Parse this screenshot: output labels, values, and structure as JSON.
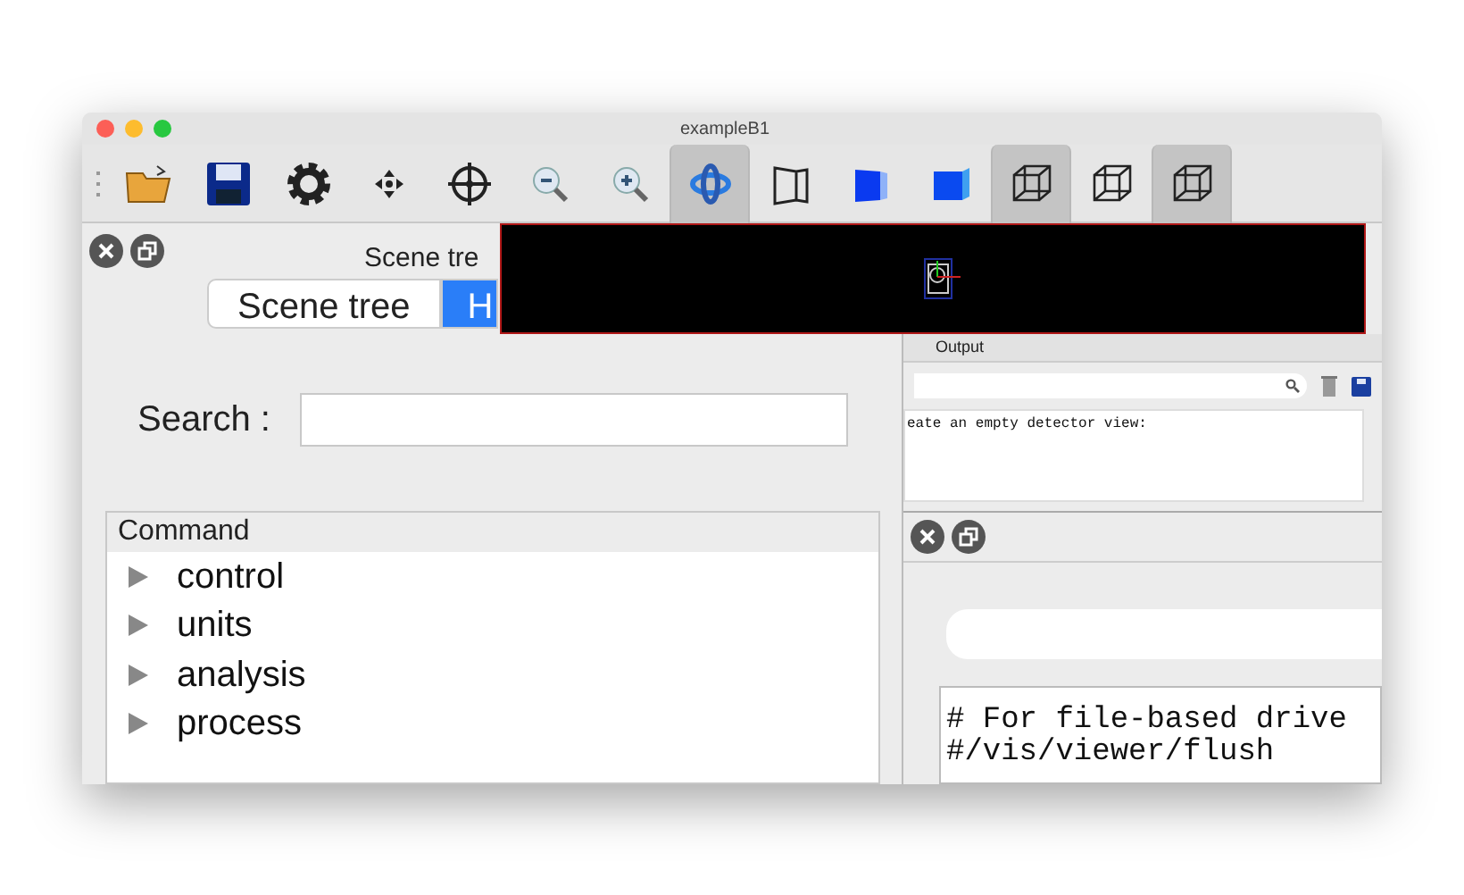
{
  "window": {
    "title": "exampleB1"
  },
  "toolbar": [
    {
      "kind": "open",
      "selected": false
    },
    {
      "kind": "save",
      "selected": false
    },
    {
      "kind": "gear",
      "selected": false
    },
    {
      "kind": "move",
      "selected": false
    },
    {
      "kind": "target",
      "selected": false
    },
    {
      "kind": "zoom-out",
      "selected": false
    },
    {
      "kind": "zoom-in",
      "selected": false
    },
    {
      "kind": "rotate",
      "selected": true
    },
    {
      "kind": "perspective",
      "selected": false
    },
    {
      "kind": "solid",
      "selected": false
    },
    {
      "kind": "solid-alt",
      "selected": false
    },
    {
      "kind": "wire",
      "selected": true
    },
    {
      "kind": "wire-alt",
      "selected": false
    },
    {
      "kind": "wire-cut",
      "selected": true
    }
  ],
  "left_dock": {
    "title": "Scene tre",
    "tabs": [
      {
        "label": "Scene tree",
        "selected": false
      },
      {
        "label": "H",
        "selected": true
      }
    ],
    "search_label": "Search :",
    "tree_header": "Command",
    "tree": [
      {
        "label": "control",
        "expanded": false
      },
      {
        "label": "units",
        "expanded": false
      },
      {
        "label": "analysis",
        "expanded": false
      },
      {
        "label": "process",
        "expanded": false
      }
    ]
  },
  "output_dock": {
    "tab": "Output",
    "text": "eate an empty detector view:"
  },
  "session_dock": {
    "history": [
      "# For file-based drive",
      "#/vis/viewer/flush"
    ]
  }
}
